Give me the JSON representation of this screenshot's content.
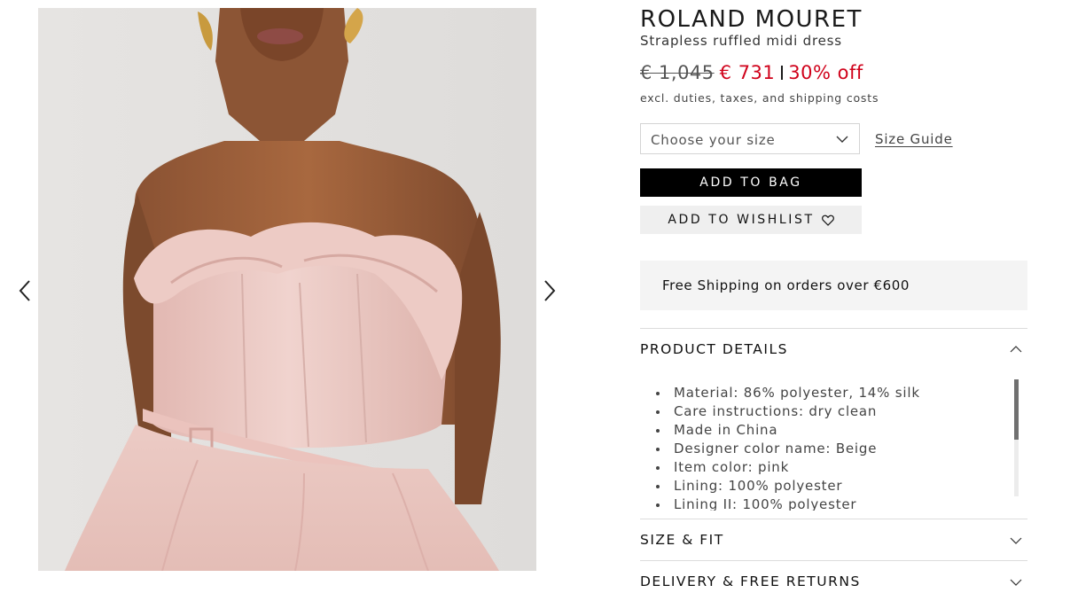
{
  "product": {
    "brand": "ROLAND MOURET",
    "name": "Strapless ruffled midi dress",
    "price_old": "€ 1,045",
    "price_new": "€ 731",
    "discount": "30% off",
    "duties_note": "excl. duties, taxes, and shipping costs"
  },
  "size": {
    "placeholder": "Choose your size",
    "guide_label": "Size Guide"
  },
  "actions": {
    "add_to_bag": "ADD TO BAG",
    "add_to_wishlist": "ADD TO WISHLIST"
  },
  "shipping_banner": "Free Shipping on orders over €600",
  "accordions": {
    "details": {
      "title": "PRODUCT DETAILS",
      "expanded": true,
      "items": [
        "Material: 86% polyester, 14% silk",
        "Care instructions: dry clean",
        "Made in China",
        "Designer color name: Beige",
        "Item color: pink",
        "Lining: 100% polyester",
        "Lining II: 100% polyester"
      ]
    },
    "size_fit": {
      "title": "SIZE & FIT",
      "expanded": false
    },
    "delivery": {
      "title": "DELIVERY & FREE RETURNS",
      "expanded": false
    }
  },
  "gallery": {
    "prev_icon": "chevron-left-icon",
    "next_icon": "chevron-right-icon"
  },
  "colors": {
    "sale_red": "#d0021b",
    "button_black": "#000000",
    "dress_pink": "#e9c6c1"
  }
}
